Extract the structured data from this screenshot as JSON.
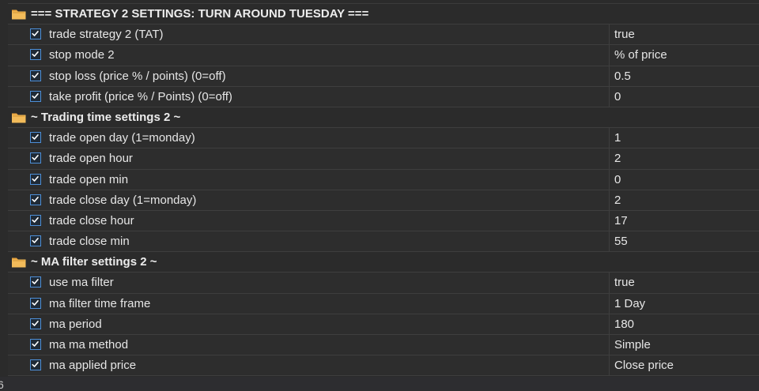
{
  "groups": [
    {
      "title": "=== STRATEGY 2 SETTINGS: TURN AROUND TUESDAY ===",
      "params": [
        {
          "name": "trade strategy 2 (TAT)",
          "value": "true"
        },
        {
          "name": "stop mode 2",
          "value": "% of price"
        },
        {
          "name": "stop loss (price % / points) (0=off)",
          "value": "0.5"
        },
        {
          "name": "take profit (price % / Points) (0=off)",
          "value": "0"
        }
      ]
    },
    {
      "title": "~ Trading time settings 2 ~",
      "params": [
        {
          "name": "trade open day (1=monday)",
          "value": "1"
        },
        {
          "name": "trade open hour",
          "value": "2"
        },
        {
          "name": "trade open min",
          "value": "0"
        },
        {
          "name": "trade close day (1=monday)",
          "value": "2"
        },
        {
          "name": "trade close hour",
          "value": "17"
        },
        {
          "name": "trade close min",
          "value": "55"
        }
      ]
    },
    {
      "title": "~ MA filter settings 2 ~",
      "params": [
        {
          "name": "use ma filter",
          "value": "true"
        },
        {
          "name": "ma filter time frame",
          "value": "1 Day"
        },
        {
          "name": "ma period",
          "value": "180"
        },
        {
          "name": "ma ma method",
          "value": "Simple"
        },
        {
          "name": "ma applied price",
          "value": "Close price"
        }
      ]
    }
  ],
  "edge_text": "6",
  "colors": {
    "folder": "#e8a33d",
    "checkbox_border": "#4d8fd8",
    "check_mark": "#ffffff"
  },
  "icons": {
    "group": "folder-icon",
    "param": "checkbox-checked-icon"
  }
}
